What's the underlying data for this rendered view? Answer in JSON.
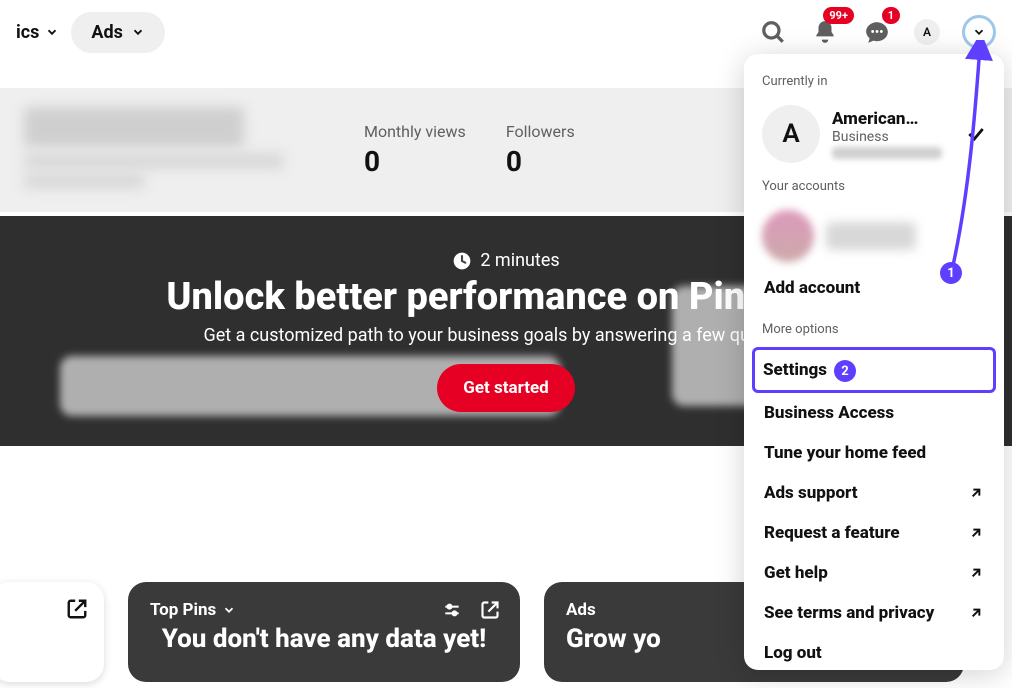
{
  "topnav": {
    "fragment_label": "ics",
    "ads_label": "Ads"
  },
  "badges": {
    "notifications": "99+",
    "messages": "1"
  },
  "avatar_letter": "A",
  "stats": {
    "monthly_views_label": "Monthly views",
    "monthly_views_value": "0",
    "followers_label": "Followers",
    "followers_value": "0"
  },
  "hero": {
    "duration": "2 minutes",
    "title": "Unlock better performance on Pinterest",
    "subtitle": "Get a customized path to your business goals by answering a few questions",
    "cta": "Get started"
  },
  "cards": {
    "top_pins_label": "Top Pins",
    "no_data": "You don't have any data yet!",
    "ads_label": "Ads",
    "grow_label": "Grow yo"
  },
  "dropdown": {
    "currently_in": "Currently in",
    "account_name": "American…",
    "account_type": "Business",
    "your_accounts": "Your accounts",
    "add_account": "Add account",
    "more_options": "More options",
    "items": {
      "settings": "Settings",
      "business_access": "Business Access",
      "tune_feed": "Tune your home feed",
      "ads_support": "Ads support",
      "request_feature": "Request a feature",
      "get_help": "Get help",
      "see_terms": "See terms and privacy",
      "log_out": "Log out"
    }
  },
  "annotations": {
    "step1": "1",
    "step2": "2"
  }
}
